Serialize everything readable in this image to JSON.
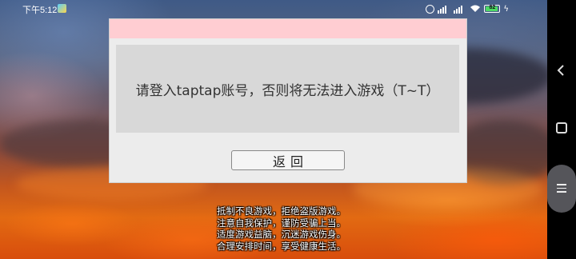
{
  "status_bar": {
    "time": "下午5:12",
    "battery": "82",
    "icons": [
      "alarm-icon",
      "signal-icon",
      "signal-icon",
      "wifi-icon",
      "battery-icon",
      "charging-icon"
    ]
  },
  "dialog": {
    "message": "请登入taptap账号，否则将无法进入游戏（T~T）",
    "back_label": "返回",
    "header_color": "#ffcdd2"
  },
  "health_notice": {
    "lines": [
      "抵制不良游戏，拒绝盗版游戏。",
      "注意自我保护，谨防受骗上当。",
      "适度游戏益脑，沉迷游戏伤身。",
      "合理安排时间，享受健康生活。"
    ]
  },
  "nav_bar": {
    "buttons": [
      "back-icon",
      "home-icon",
      "menu-icon"
    ]
  }
}
